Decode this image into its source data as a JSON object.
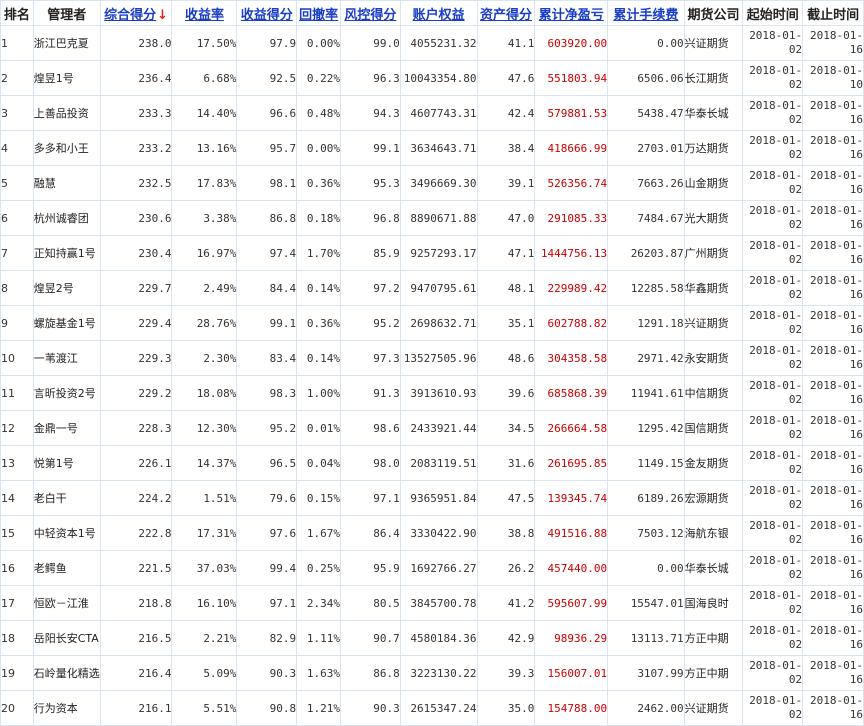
{
  "headers": [
    {
      "key": "rank",
      "label": "排名",
      "link": false
    },
    {
      "key": "manager",
      "label": "管理者",
      "link": false
    },
    {
      "key": "score",
      "label": "综合得分",
      "link": true,
      "sorted": true,
      "sort_indicator": "↓"
    },
    {
      "key": "return_rate",
      "label": "收益率",
      "link": true
    },
    {
      "key": "return_score",
      "label": "收益得分",
      "link": true
    },
    {
      "key": "drawdown",
      "label": "回撤率",
      "link": true
    },
    {
      "key": "risk_score",
      "label": "风控得分",
      "link": true
    },
    {
      "key": "equity",
      "label": "账户权益",
      "link": true
    },
    {
      "key": "asset_score",
      "label": "资产得分",
      "link": true
    },
    {
      "key": "net_profit",
      "label": "累计净盈亏",
      "link": true
    },
    {
      "key": "fees",
      "label": "累计手续费",
      "link": true
    },
    {
      "key": "company",
      "label": "期货公司",
      "link": false
    },
    {
      "key": "start",
      "label": "起始时间",
      "link": false
    },
    {
      "key": "end",
      "label": "截止时间",
      "link": false
    }
  ],
  "colors": {
    "header_link": "#1a3dc8",
    "sort_arrow": "#e02020",
    "profit": "#cc0000",
    "border": "#d9e5f1"
  },
  "rows": [
    {
      "rank": "1",
      "manager": "浙江巴克夏",
      "score": "238.0",
      "return_rate": "17.50%",
      "return_score": "97.9",
      "drawdown": "0.00%",
      "risk_score": "99.0",
      "equity": "4055231.32",
      "asset_score": "41.1",
      "net_profit": "603920.00",
      "net_red": true,
      "fees": "0.00",
      "company": "兴证期货",
      "start_a": "2018-01-",
      "start_b": "02",
      "end_a": "2018-01-",
      "end_b": "16"
    },
    {
      "rank": "2",
      "manager": "煌昱1号",
      "score": "236.4",
      "return_rate": "6.68%",
      "return_score": "92.5",
      "drawdown": "0.22%",
      "risk_score": "96.3",
      "equity": "10043354.80",
      "asset_score": "47.6",
      "net_profit": "551803.94",
      "net_red": true,
      "fees": "6506.06",
      "company": "长江期货",
      "start_a": "2018-01-",
      "start_b": "02",
      "end_a": "2018-01-",
      "end_b": "10"
    },
    {
      "rank": "3",
      "manager": "上善品投资",
      "score": "233.3",
      "return_rate": "14.40%",
      "return_score": "96.6",
      "drawdown": "0.48%",
      "risk_score": "94.3",
      "equity": "4607743.31",
      "asset_score": "42.4",
      "net_profit": "579881.53",
      "net_red": true,
      "fees": "5438.47",
      "company": "华泰长城",
      "start_a": "2018-01-",
      "start_b": "02",
      "end_a": "2018-01-",
      "end_b": "16"
    },
    {
      "rank": "4",
      "manager": "多多和小王",
      "score": "233.2",
      "return_rate": "13.16%",
      "return_score": "95.7",
      "drawdown": "0.00%",
      "risk_score": "99.1",
      "equity": "3634643.71",
      "asset_score": "38.4",
      "net_profit": "418666.99",
      "net_red": true,
      "fees": "2703.01",
      "company": "万达期货",
      "start_a": "2018-01-",
      "start_b": "02",
      "end_a": "2018-01-",
      "end_b": "16"
    },
    {
      "rank": "5",
      "manager": "融慧",
      "score": "232.5",
      "return_rate": "17.83%",
      "return_score": "98.1",
      "drawdown": "0.36%",
      "risk_score": "95.3",
      "equity": "3496669.30",
      "asset_score": "39.1",
      "net_profit": "526356.74",
      "net_red": true,
      "fees": "7663.26",
      "company": "山金期货",
      "start_a": "2018-01-",
      "start_b": "02",
      "end_a": "2018-01-",
      "end_b": "16"
    },
    {
      "rank": "6",
      "manager": "杭州诚睿团",
      "score": "230.6",
      "return_rate": "3.38%",
      "return_score": "86.8",
      "drawdown": "0.18%",
      "risk_score": "96.8",
      "equity": "8890671.88",
      "asset_score": "47.0",
      "net_profit": "291085.33",
      "net_red": true,
      "fees": "7484.67",
      "company": "光大期货",
      "start_a": "2018-01-",
      "start_b": "02",
      "end_a": "2018-01-",
      "end_b": "16"
    },
    {
      "rank": "7",
      "manager": "正知持赢1号",
      "score": "230.4",
      "return_rate": "16.97%",
      "return_score": "97.4",
      "drawdown": "1.70%",
      "risk_score": "85.9",
      "equity": "9257293.17",
      "asset_score": "47.1",
      "net_profit": "1444756.13",
      "net_red": true,
      "fees": "26203.87",
      "company": "广州期货",
      "start_a": "2018-01-",
      "start_b": "02",
      "end_a": "2018-01-",
      "end_b": "16"
    },
    {
      "rank": "8",
      "manager": "煌昱2号",
      "score": "229.7",
      "return_rate": "2.49%",
      "return_score": "84.4",
      "drawdown": "0.14%",
      "risk_score": "97.2",
      "equity": "9470795.61",
      "asset_score": "48.1",
      "net_profit": "229989.42",
      "net_red": true,
      "fees": "12285.58",
      "company": "华鑫期货",
      "start_a": "2018-01-",
      "start_b": "02",
      "end_a": "2018-01-",
      "end_b": "16"
    },
    {
      "rank": "9",
      "manager": "螺旋基金1号",
      "score": "229.4",
      "return_rate": "28.76%",
      "return_score": "99.1",
      "drawdown": "0.36%",
      "risk_score": "95.2",
      "equity": "2698632.71",
      "asset_score": "35.1",
      "net_profit": "602788.82",
      "net_red": true,
      "fees": "1291.18",
      "company": "兴证期货",
      "start_a": "2018-01-",
      "start_b": "02",
      "end_a": "2018-01-",
      "end_b": "16"
    },
    {
      "rank": "10",
      "manager": "一苇渡江",
      "score": "229.3",
      "return_rate": "2.30%",
      "return_score": "83.4",
      "drawdown": "0.14%",
      "risk_score": "97.3",
      "equity": "13527505.96",
      "asset_score": "48.6",
      "net_profit": "304358.58",
      "net_red": true,
      "fees": "2971.42",
      "company": "永安期货",
      "start_a": "2018-01-",
      "start_b": "02",
      "end_a": "2018-01-",
      "end_b": "16"
    },
    {
      "rank": "11",
      "manager": "言昕投资2号",
      "score": "229.2",
      "return_rate": "18.08%",
      "return_score": "98.3",
      "drawdown": "1.00%",
      "risk_score": "91.3",
      "equity": "3913610.93",
      "asset_score": "39.6",
      "net_profit": "685868.39",
      "net_red": true,
      "fees": "11941.61",
      "company": "中信期货",
      "start_a": "2018-01-",
      "start_b": "02",
      "end_a": "2018-01-",
      "end_b": "16"
    },
    {
      "rank": "12",
      "manager": "金鼎一号",
      "score": "228.3",
      "return_rate": "12.30%",
      "return_score": "95.2",
      "drawdown": "0.01%",
      "risk_score": "98.6",
      "equity": "2433921.44",
      "asset_score": "34.5",
      "net_profit": "266664.58",
      "net_red": true,
      "fees": "1295.42",
      "company": "国信期货",
      "start_a": "2018-01-",
      "start_b": "02",
      "end_a": "2018-01-",
      "end_b": "16"
    },
    {
      "rank": "13",
      "manager": "悦第1号",
      "score": "226.1",
      "return_rate": "14.37%",
      "return_score": "96.5",
      "drawdown": "0.04%",
      "risk_score": "98.0",
      "equity": "2083119.51",
      "asset_score": "31.6",
      "net_profit": "261695.85",
      "net_red": true,
      "fees": "1149.15",
      "company": "金友期货",
      "start_a": "2018-01-",
      "start_b": "02",
      "end_a": "2018-01-",
      "end_b": "16"
    },
    {
      "rank": "14",
      "manager": "老白干",
      "score": "224.2",
      "return_rate": "1.51%",
      "return_score": "79.6",
      "drawdown": "0.15%",
      "risk_score": "97.1",
      "equity": "9365951.84",
      "asset_score": "47.5",
      "net_profit": "139345.74",
      "net_red": true,
      "fees": "6189.26",
      "company": "宏源期货",
      "start_a": "2018-01-",
      "start_b": "02",
      "end_a": "2018-01-",
      "end_b": "16"
    },
    {
      "rank": "15",
      "manager": "中轻资本1号",
      "score": "222.8",
      "return_rate": "17.31%",
      "return_score": "97.6",
      "drawdown": "1.67%",
      "risk_score": "86.4",
      "equity": "3330422.90",
      "asset_score": "38.8",
      "net_profit": "491516.88",
      "net_red": true,
      "fees": "7503.12",
      "company": "海航东银",
      "start_a": "2018-01-",
      "start_b": "02",
      "end_a": "2018-01-",
      "end_b": "16"
    },
    {
      "rank": "16",
      "manager": "老鳄鱼",
      "score": "221.5",
      "return_rate": "37.03%",
      "return_score": "99.4",
      "drawdown": "0.25%",
      "risk_score": "95.9",
      "equity": "1692766.27",
      "asset_score": "26.2",
      "net_profit": "457440.00",
      "net_red": true,
      "fees": "0.00",
      "company": "华泰长城",
      "start_a": "2018-01-",
      "start_b": "02",
      "end_a": "2018-01-",
      "end_b": "16"
    },
    {
      "rank": "17",
      "manager": "恒欧－江淮",
      "score": "218.8",
      "return_rate": "16.10%",
      "return_score": "97.1",
      "drawdown": "2.34%",
      "risk_score": "80.5",
      "equity": "3845700.78",
      "asset_score": "41.2",
      "net_profit": "595607.99",
      "net_red": true,
      "fees": "15547.01",
      "company": "国海良时",
      "start_a": "2018-01-",
      "start_b": "02",
      "end_a": "2018-01-",
      "end_b": "16"
    },
    {
      "rank": "18",
      "manager": "岳阳长安CTA",
      "score": "216.5",
      "return_rate": "2.21%",
      "return_score": "82.9",
      "drawdown": "1.11%",
      "risk_score": "90.7",
      "equity": "4580184.36",
      "asset_score": "42.9",
      "net_profit": "98936.29",
      "net_red": true,
      "fees": "13113.71",
      "company": "方正中期",
      "start_a": "2018-01-",
      "start_b": "02",
      "end_a": "2018-01-",
      "end_b": "16"
    },
    {
      "rank": "19",
      "manager": "石岭量化精选",
      "score": "216.4",
      "return_rate": "5.09%",
      "return_score": "90.3",
      "drawdown": "1.63%",
      "risk_score": "86.8",
      "equity": "3223130.22",
      "asset_score": "39.3",
      "net_profit": "156007.01",
      "net_red": true,
      "fees": "3107.99",
      "company": "方正中期",
      "start_a": "2018-01-",
      "start_b": "02",
      "end_a": "2018-01-",
      "end_b": "16"
    },
    {
      "rank": "20",
      "manager": "行为资本",
      "score": "216.1",
      "return_rate": "5.51%",
      "return_score": "90.8",
      "drawdown": "1.21%",
      "risk_score": "90.3",
      "equity": "2615347.24",
      "asset_score": "35.0",
      "net_profit": "154788.00",
      "net_red": true,
      "fees": "2462.00",
      "company": "兴证期货",
      "start_a": "2018-01-",
      "start_b": "02",
      "end_a": "2018-01-",
      "end_b": "16"
    }
  ]
}
